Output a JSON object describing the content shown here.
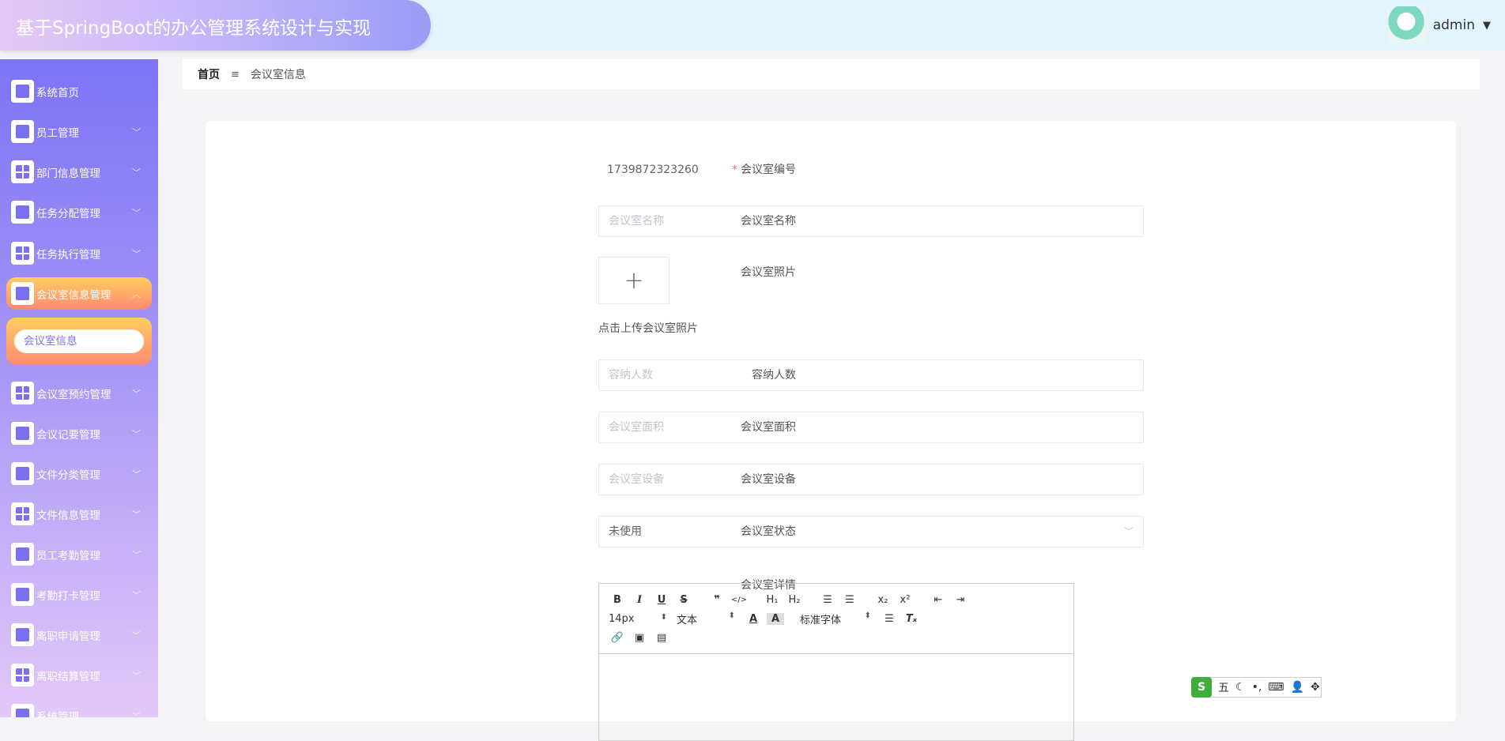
{
  "header": {
    "title": "基于SpringBoot的办公管理系统设计与实现",
    "user": "admin"
  },
  "breadcrumb": {
    "home": "首页",
    "separator": "≡",
    "current": "会议室信息"
  },
  "sidebar": {
    "items": [
      {
        "label": "系统首页",
        "icon": "home-icon",
        "expandable": false
      },
      {
        "label": "员工管理",
        "icon": "monitor-icon",
        "expandable": true
      },
      {
        "label": "部门信息管理",
        "icon": "grid-icon",
        "expandable": true
      },
      {
        "label": "任务分配管理",
        "icon": "clipboard-icon",
        "expandable": true
      },
      {
        "label": "任务执行管理",
        "icon": "grid-icon",
        "expandable": true
      },
      {
        "label": "会议室信息管理",
        "icon": "brush-icon",
        "expandable": true,
        "active": true
      },
      {
        "label": "会议室预约管理",
        "icon": "grid-icon",
        "expandable": true
      },
      {
        "label": "会议记要管理",
        "icon": "clipboard-check-icon",
        "expandable": true
      },
      {
        "label": "文件分类管理",
        "icon": "sliders-icon",
        "expandable": true
      },
      {
        "label": "文件信息管理",
        "icon": "grid-icon",
        "expandable": true
      },
      {
        "label": "员工考勤管理",
        "icon": "briefcase-icon",
        "expandable": true
      },
      {
        "label": "考勤打卡管理",
        "icon": "user-icon",
        "expandable": true
      },
      {
        "label": "离职申请管理",
        "icon": "shop-icon",
        "expandable": true
      },
      {
        "label": "离职结算管理",
        "icon": "grid-icon",
        "expandable": true
      },
      {
        "label": "系统管理",
        "icon": "list-icon",
        "expandable": true
      }
    ],
    "submenu": {
      "label": "会议室信息"
    }
  },
  "form": {
    "code": {
      "label": "会议室编号",
      "value": "1739872323260",
      "required": true
    },
    "name": {
      "label": "会议室名称",
      "placeholder": "会议室名称"
    },
    "photo": {
      "label": "会议室照片",
      "hint": "点击上传会议室照片",
      "button": "+"
    },
    "capacity": {
      "label": "容纳人数",
      "placeholder": "容纳人数"
    },
    "area": {
      "label": "会议室面积",
      "placeholder": "会议室面积"
    },
    "equipment": {
      "label": "会议室设备",
      "placeholder": "会议室设备"
    },
    "status": {
      "label": "会议室状态",
      "value": "未使用"
    },
    "detail": {
      "label": "会议室详情",
      "toolbar": {
        "font_size": "14px",
        "heading": "文本",
        "font_family": "标准字体"
      }
    }
  },
  "ime": {
    "mode": "五"
  }
}
